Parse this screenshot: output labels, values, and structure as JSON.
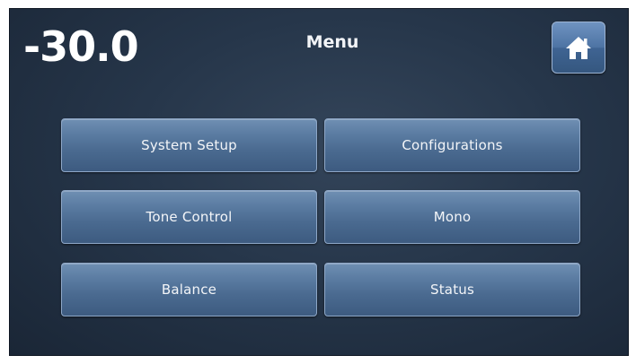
{
  "header": {
    "volume": "-30.0",
    "title": "Menu"
  },
  "icons": {
    "home": "home-icon"
  },
  "menu": {
    "buttons": [
      {
        "label": "System Setup"
      },
      {
        "label": "Configurations"
      },
      {
        "label": "Tone Control"
      },
      {
        "label": "Mono"
      },
      {
        "label": "Balance"
      },
      {
        "label": "Status"
      }
    ]
  },
  "colors": {
    "background": "#26364a",
    "button": "#4a6a90",
    "home_button": "#4d73a3",
    "text": "#ffffff"
  }
}
